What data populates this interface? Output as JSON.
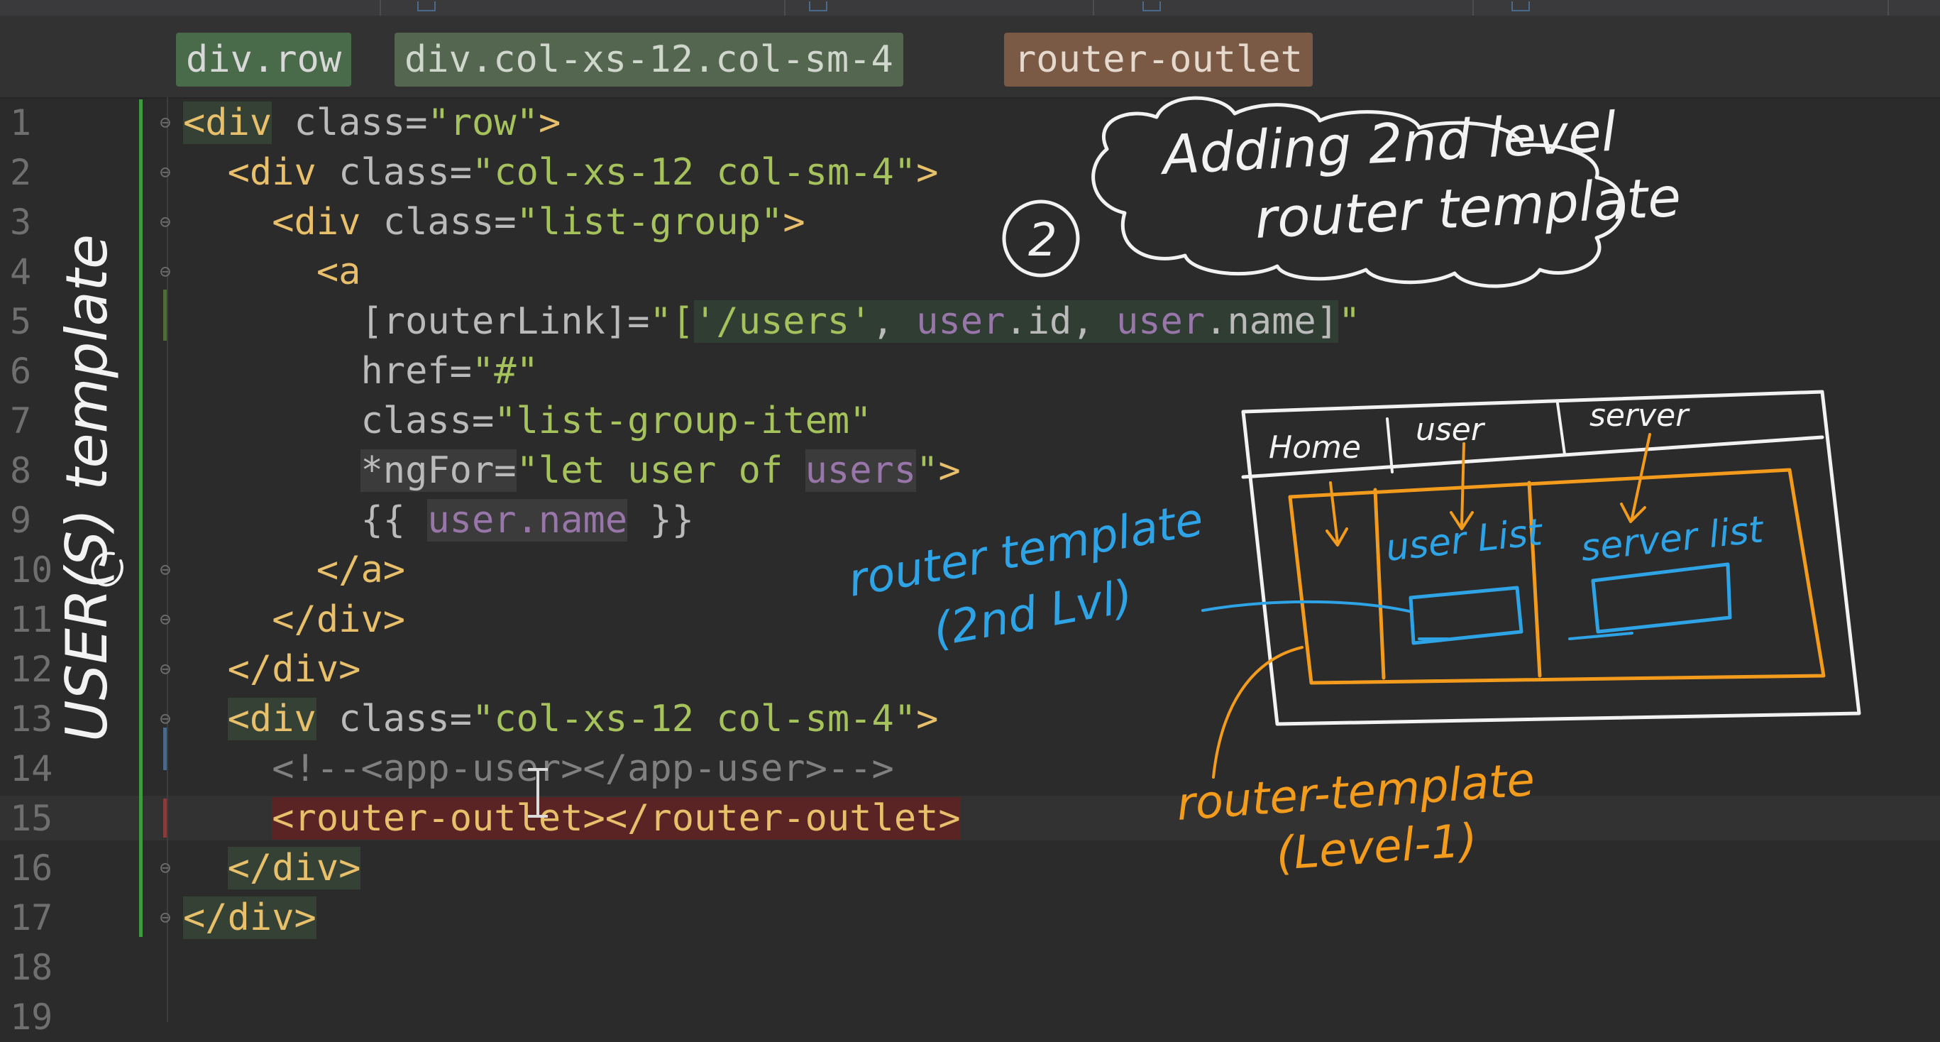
{
  "breadcrumbs": [
    "div.row",
    "div.col-xs-12.col-sm-4",
    "router-outlet"
  ],
  "line_numbers": [
    "1",
    "2",
    "3",
    "4",
    "5",
    "6",
    "7",
    "8",
    "9",
    "10",
    "11",
    "12",
    "13",
    "14",
    "15",
    "16",
    "17",
    "18",
    "19"
  ],
  "code": {
    "l1_tag": "<div",
    "l1_attr": " class=",
    "l1_val": "\"row\"",
    "l1_close": ">",
    "l2_indent": "  ",
    "l2_tag": "<div",
    "l2_attr": " class=",
    "l2_val": "\"col-xs-12 col-sm-4\"",
    "l2_close": ">",
    "l3_indent": "    ",
    "l3_tag": "<div",
    "l3_attr": " class=",
    "l3_val": "\"list-group\"",
    "l3_close": ">",
    "l4_indent": "      ",
    "l4_tag": "<a",
    "l5_indent": "        ",
    "l5_attr": "[routerLink]=",
    "l5_q": "\"[",
    "l5_s": "'/users'",
    "l5_sep1": ", ",
    "l5_v1": "user",
    "l5_p1": ".id",
    "l5_sep2": ", ",
    "l5_v2": "user",
    "l5_p2": ".name]",
    "l5_end": "\"",
    "l6_indent": "        ",
    "l6_attr": "href=",
    "l6_val": "\"#\"",
    "l7_indent": "        ",
    "l7_attr": "class=",
    "l7_val": "\"list-group-item\"",
    "l8_indent": "        ",
    "l8_attr": "*ngFor=",
    "l8_val1": "\"let user of ",
    "l8_var": "users",
    "l8_val2": "\"",
    "l8_close": ">",
    "l9_indent": "        ",
    "l9_open": "{{ ",
    "l9_var": "user",
    "l9_prop": ".name",
    "l9_close": " }}",
    "l10_indent": "      ",
    "l10_tag": "</a>",
    "l11_indent": "    ",
    "l11_tag": "</div>",
    "l12_indent": "  ",
    "l12_tag": "</div>",
    "l13_indent": "  ",
    "l13_tag": "<div",
    "l13_attr": " class=",
    "l13_val": "\"col-xs-12 col-sm-4\"",
    "l13_close": ">",
    "l14_indent": "    ",
    "l14_cmt": "<!--<app-user></app-user>-->",
    "l15_indent": "    ",
    "l15_tag": "<router-outlet></router-outlet>",
    "l16_indent": "  ",
    "l16_tag": "</div>",
    "l17_tag": "</div>"
  },
  "annotations": {
    "step_number": "2",
    "cloud_line1": "Adding 2nd level",
    "cloud_line2": "router template",
    "side_label": "USER(S) template",
    "router_template_2nd": "router template",
    "router_template_2nd_sub": "(2nd Lvl)",
    "router_template_l1": "router-template",
    "router_template_l1_sub": "(Level-1)",
    "tab_home": "Home",
    "tab_user": "user",
    "tab_server": "server",
    "user_list": "user List",
    "server_list": "server list"
  },
  "colors": {
    "background": "#2b2b2b",
    "ink_white": "#f2f2f2",
    "ink_orange": "#f29b1d",
    "ink_blue": "#2ea3e6"
  }
}
